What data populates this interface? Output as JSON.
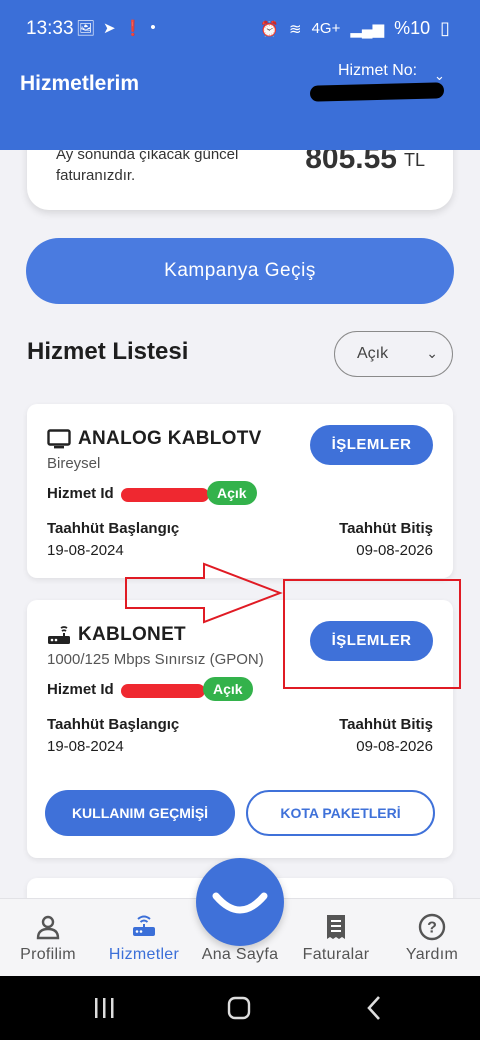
{
  "status_bar": {
    "time": "13:33",
    "battery_text": "%10",
    "network": "4G+"
  },
  "header": {
    "title": "Hizmetlerim",
    "service_no_label": "Hizmet No:"
  },
  "bill_card": {
    "description": "Ay sonunda çıkacak güncel faturanızdır.",
    "amount": "805.55",
    "currency": "TL"
  },
  "campaign_button": "Kampanya Geçiş",
  "list": {
    "title": "Hizmet Listesi",
    "filter_value": "Açık"
  },
  "services": [
    {
      "name": "ANALOG KABLOTV",
      "subtitle": "Bireysel",
      "id_label": "Hizmet Id",
      "status": "Açık",
      "ops_label": "İŞLEMLER",
      "start_label": "Taahhüt Başlangıç",
      "start_date": "19-08-2024",
      "end_label": "Taahhüt Bitiş",
      "end_date": "09-08-2026"
    },
    {
      "name": "KABLONET",
      "subtitle": "1000/125 Mbps Sınırsız (GPON)",
      "id_label": "Hizmet Id",
      "status": "Açık",
      "ops_label": "İŞLEMLER",
      "start_label": "Taahhüt Başlangıç",
      "start_date": "19-08-2024",
      "end_label": "Taahhüt Bitiş",
      "end_date": "09-08-2026",
      "usage_button": "KULLANIM GEÇMİŞİ",
      "quota_button": "KOTA PAKETLERİ"
    }
  ],
  "bottom_nav": [
    {
      "label": "Profilim",
      "icon": "person-icon"
    },
    {
      "label": "Hizmetler",
      "icon": "router-icon",
      "active": true
    },
    {
      "label": "Ana Sayfa",
      "icon": "smile-icon"
    },
    {
      "label": "Faturalar",
      "icon": "receipt-icon"
    },
    {
      "label": "Yardım",
      "icon": "help-icon"
    }
  ],
  "colors": {
    "primary": "#3b6fd8",
    "status_open": "#33b24b",
    "annotation": "#e01b24"
  }
}
